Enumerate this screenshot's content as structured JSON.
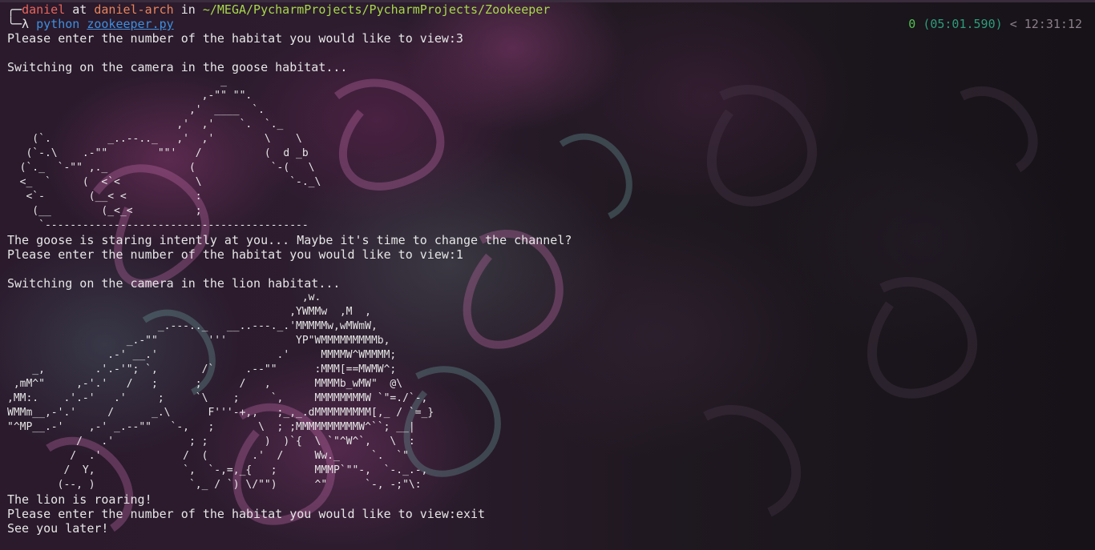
{
  "prompt": {
    "corner_top": "╭─",
    "user": "daniel",
    "at": " at ",
    "host": "daniel-arch",
    "in": " in ",
    "path": "~/MEGA/PycharmProjects/PycharmProjects/Zookeeper",
    "corner_bottom": "╰─λ ",
    "command": "python",
    "argument": "zookeeper.py"
  },
  "status": {
    "exit_code": "0",
    "elapsed": "(05:01.590)",
    "separator": "<",
    "clock": "12:31:12"
  },
  "output": {
    "line_01": "Please enter the number of the habitat you would like to view:3",
    "line_02": "",
    "line_03": "Switching on the camera in the goose habitat...",
    "goose_art": "                                  _\n                               ,-\"\" \"\".\n                             ,'  ____  `.\n                           ,'  ,'    `.  `._\n    (`.         _..--.._   ,'  ,'        \\    \\\n   (`-.\\    .-\"\"        \"\"'   /          (  d _b\n  (`._  `-\"\" ,._             (            `-(   \\\n  <_  `     (  <`<            \\              `-._\\\n   <`-       (__< <           :\n    (__        (_<_<          ;\n     `------------------------------------------",
    "line_04": "The goose is staring intently at you... Maybe it's time to change the channel?",
    "line_05": "Please enter the number of the habitat you would like to view:1",
    "line_06": "",
    "line_07": "Switching on the camera in the lion habitat...",
    "lion_art": "                                               ,w.\n                                             ,YWMMw  ,M  ,\n                        _.---.._   __..---._.'MMMMMw,wMWmW,\n                   _.-\"\"        '''           YP\"WMMMMMMMMMb,\n                .-' __.'                   .'     MMMMW^WMMMM;\n    _,        .'.-'\"; `,       /`     .--\"\"      :MMM[==MWMW^;\n ,mM^\"     ,-'.'   /   ;      ;      /   ,       MMMMb_wMW\"  @\\\n,MM:.    .'.-'   .'     ;     `\\    ;     `,     MMMMMMMMW `\"=./`-,\nWMMm__,-'.'     /      _.\\      F'''-+,,   ;_,_.dMMMMMMMMM[,_ / `=_}\n\"^MP__.-'    ,-' _.--\"\"   `-,   ;       \\  ; ;MMMMMMMMMMW^``; __|\n           /   .'            ; ;         )  )`{  \\ `\"^W^`,   \\  :\n          /  .'             /  (       .'  /     Ww._     `.  `\"\n         /  Y,              `,  `-,=,_{   ;      MMMP`\"\"-,  `-._.-,\n        (--, )               `,_ / `) \\/\"\")      ^\"      `-, -;\"\\:",
    "line_08": "The lion is roaring!",
    "line_09": "Please enter the number of the habitat you would like to view:exit",
    "line_10": "See you later!"
  }
}
